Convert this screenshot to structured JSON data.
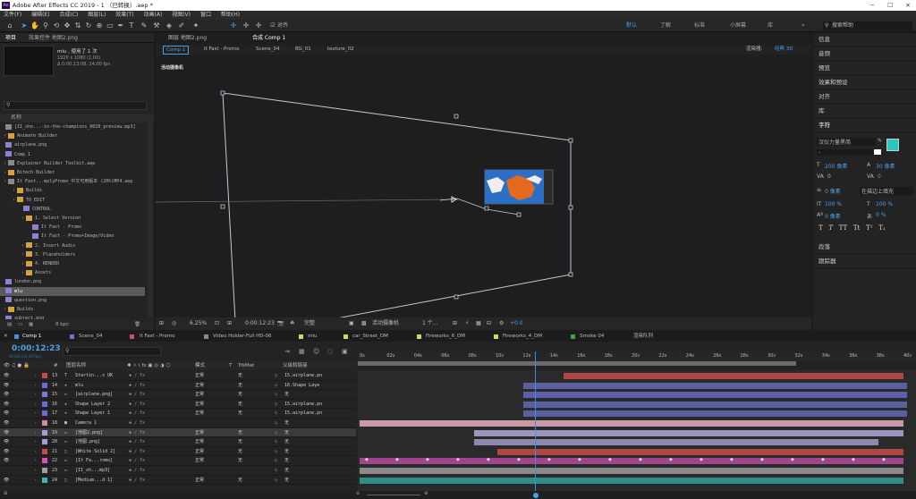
{
  "app": {
    "title": "Adobe After Effects CC 2019 - 1 （已转换）.aep *",
    "logo": "Ae"
  },
  "menu": [
    "文件(F)",
    "编辑(E)",
    "合成(C)",
    "图层(L)",
    "效果(T)",
    "动画(A)",
    "视图(V)",
    "窗口",
    "帮助(H)"
  ],
  "toolbar": {
    "snap_label": "对齐"
  },
  "workspaces": [
    "默认",
    "了解",
    "标准",
    "小屏幕",
    "库"
  ],
  "search_placeholder": "搜索帮助",
  "project": {
    "tabs": [
      "项目",
      "效果控件 地图2.png"
    ],
    "selected_name": "mlu",
    "used": ", 使用了 1 次",
    "res": "1920 x 1080 (1.00)",
    "dur": "Δ 0:00:13:08, 24.00 fps",
    "search_placeholder": "",
    "name_header": "名称",
    "bpc": "8 bpc",
    "items": [
      "[II_sho...-in-the-champions_0020_preview.mp3]",
      "Animate Builder",
      "airplane.png",
      "Comp 1",
      "Explainer Builder Toolkit.aep",
      "Bitech Builder",
      "It Fast...mplyPromo_中文可用版本 (20%)MP4.aep",
      "Builds",
      "TO EDIT",
      "CONTROL",
      "1. Select Version",
      "It Fast - Promo",
      "It Fast - Promo+Image/Video",
      "2. Insert Audio",
      "3. Placeholders",
      "4. RENDER",
      "Assets",
      "london.png",
      "mlu",
      "question.png",
      "Builds",
      "subject.png"
    ]
  },
  "viewer": {
    "tabs": [
      "图层 地图2.png",
      "合成 Comp 1"
    ],
    "crumbs": [
      "Comp 1",
      "It Fast - Promo",
      "Scene_04",
      "BG_01",
      "texture_02"
    ],
    "renderer_label": "渲染器:",
    "renderer_value": "经典 3D",
    "camera_label": "活动摄像机",
    "zoom": "6.25%",
    "time": "0:00:12:23",
    "quality": "完整",
    "camera_select": "活动摄像机",
    "views": "1 个...",
    "exposure": "+0.0"
  },
  "right": {
    "panels": [
      "信息",
      "音频",
      "预览",
      "效果和预设",
      "对齐",
      "库",
      "字符",
      "段落",
      "跟踪器"
    ],
    "font": "汉仪力量黑简",
    "style": "-",
    "size": "200 像素",
    "leading": "30 像素",
    "kerning": "0",
    "tracking": "0",
    "stroke": "0 像素",
    "stroke_mode": "在描边上填充",
    "vscale": "100 %",
    "hscale": "100 %",
    "baseline": "0 像素",
    "tsume": "0 %",
    "typo": [
      "T",
      "T",
      "TT",
      "Tt",
      "T¹",
      "T₁"
    ],
    "fill_color": "#2cc6c0"
  },
  "timeline": {
    "tabs": [
      "Comp 1",
      "Scene_04",
      "It Fast - Promo",
      "Video Holder-Full HD-06",
      "mlu",
      "car_Street_DM",
      "Fireworks_6_DM",
      "Fireworks_4_DM",
      "Smoke 04",
      "渲染队列"
    ],
    "tab_colors": [
      "#4b8fd8",
      "#7a6cd6",
      "#c8506a",
      "#8a8a8a",
      "#d7d760",
      "#d7d760",
      "#d7d760",
      "#d7d760",
      "#3aa04a",
      ""
    ],
    "timecode": "0:00:12:23",
    "timecode_sub": "00310 (24.00 fps)",
    "cols": [
      "#",
      "图层名称",
      "模式",
      "T",
      "TrkMat",
      "父级和链接"
    ],
    "ruler": [
      "0s",
      "02s",
      "04s",
      "06s",
      "08s",
      "10s",
      "12s",
      "14s",
      "16s",
      "18s",
      "20s",
      "22s",
      "24s",
      "26s",
      "28s",
      "30s",
      "32s",
      "34s",
      "36s",
      "38s",
      "40s"
    ],
    "layers": [
      {
        "num": "13",
        "name": "Startin...s UK",
        "mode": "正常",
        "trk": "无",
        "parent": "15.airplane.pn",
        "color": "#c84a4a",
        "icon": "T"
      },
      {
        "num": "14",
        "name": "mlu",
        "mode": "正常",
        "trk": "无",
        "parent": "16.Shape Laye",
        "color": "#6a6adc",
        "icon": "★"
      },
      {
        "num": "15",
        "name": "[airplane.png]",
        "mode": "正常",
        "trk": "无",
        "parent": "无",
        "color": "#7a7ad6",
        "icon": "▭"
      },
      {
        "num": "16",
        "name": "Shape Layer 2",
        "mode": "正常",
        "trk": "无",
        "parent": "15.airplane.pn",
        "color": "#6a6adc",
        "icon": "★"
      },
      {
        "num": "17",
        "name": "Shape Layer 1",
        "mode": "正常",
        "trk": "无",
        "parent": "15.airplane.pn",
        "color": "#6a6adc",
        "icon": "★"
      },
      {
        "num": "18",
        "name": "Camera 1",
        "mode": "",
        "trk": "",
        "parent": "无",
        "color": "#d48aa0",
        "icon": "■"
      },
      {
        "num": "19",
        "name": "[地图2.png]",
        "mode": "正常",
        "trk": "无",
        "parent": "无",
        "color": "#a99cd6",
        "icon": "▭"
      },
      {
        "num": "20",
        "name": "[地图.png]",
        "mode": "正常",
        "trk": "无",
        "parent": "无",
        "color": "#a99cd6",
        "icon": "▭"
      },
      {
        "num": "21",
        "name": "[White Solid 2]",
        "mode": "正常",
        "trk": "无",
        "parent": "无",
        "color": "#c84a4a",
        "icon": "□"
      },
      {
        "num": "22",
        "name": "[It Fa...romo]",
        "mode": "正常",
        "trk": "无",
        "parent": "无",
        "color": "#d850b8",
        "icon": "▭"
      },
      {
        "num": "23",
        "name": "[II_sh...mp3]",
        "mode": "",
        "trk": "",
        "parent": "无",
        "color": "#a0a0a0",
        "icon": "▭"
      },
      {
        "num": "24",
        "name": "[Medium...d 1]",
        "mode": "正常",
        "trk": "无",
        "parent": "无",
        "color": "#3ab8b0",
        "icon": "□"
      }
    ]
  }
}
